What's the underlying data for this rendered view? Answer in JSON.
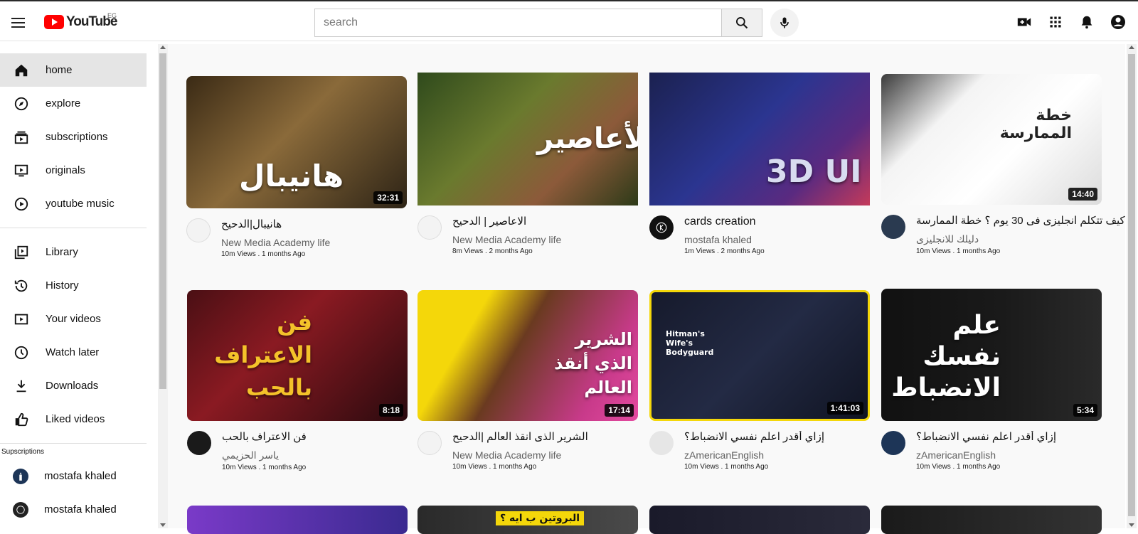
{
  "header": {
    "logo_text": "YouTube",
    "country_code": "EG",
    "search_placeholder": "search"
  },
  "sidebar": {
    "main": [
      {
        "label": "home",
        "icon": "home-icon",
        "active": true
      },
      {
        "label": "explore",
        "icon": "compass-icon"
      },
      {
        "label": "subscriptions",
        "icon": "subscriptions-icon"
      },
      {
        "label": "originals",
        "icon": "originals-icon"
      },
      {
        "label": "youtube music",
        "icon": "music-icon"
      }
    ],
    "library": [
      {
        "label": "Library",
        "icon": "library-icon"
      },
      {
        "label": "History",
        "icon": "history-icon"
      },
      {
        "label": "Your videos",
        "icon": "your-videos-icon"
      },
      {
        "label": "Watch later",
        "icon": "clock-icon"
      },
      {
        "label": "Downloads",
        "icon": "download-icon"
      },
      {
        "label": "Liked videos",
        "icon": "thumbs-up-icon"
      }
    ],
    "subscriptions_heading": "Supscriptions",
    "subscriptions": [
      {
        "label": "mostafa khaled"
      },
      {
        "label": "mostafa khaled"
      }
    ]
  },
  "videos": [
    {
      "title": "هانيبال|الدحيح",
      "channel": "New Media Academy life",
      "stats": "10m Views . 1 months Ago",
      "duration": "32:31",
      "thumb_text": "هانيبال"
    },
    {
      "title": "الاعاصير | الدحيح",
      "channel": "New Media Academy life",
      "stats": "8m Views . 2 months Ago",
      "duration": "",
      "thumb_text": "الأعاصير"
    },
    {
      "title": "cards creation",
      "channel": "mostafa khaled",
      "stats": "1m Views . 2 months Ago",
      "duration": "",
      "thumb_text": "3D UI"
    },
    {
      "title": "كيف تتكلم انجليزى فى 30 يوم ؟ خطة الممارسة",
      "channel": "دليلك للانجليزى",
      "stats": "10m Views . 1 months Ago",
      "duration": "14:40",
      "thumb_text": "خطة الممارسة"
    },
    {
      "title": "فن الاعتراف بالحب",
      "channel": "ياسر الحزيمي",
      "stats": "10m Views . 1 months Ago",
      "duration": "8:18",
      "thumb_text": "فن الاعتراف بالحب"
    },
    {
      "title": "الشرير الذى انقذ العالم |الدحيح",
      "channel": "New Media Academy life",
      "stats": "10m Views . 1 months Ago",
      "duration": "17:14",
      "thumb_text": "الشرير الذي أنقذ العالم"
    },
    {
      "title": "إزاي أقدر اعلم نفسي الانضباط؟",
      "channel": "zAmericanEnglish",
      "stats": "10m Views . 1 months Ago",
      "duration": "1:41:03",
      "thumb_text": "Hitman's Wife's Bodyguard"
    },
    {
      "title": "إزاي أقدر اعلم نفسي الانضباط؟",
      "channel": "zAmericanEnglish",
      "stats": "10m Views . 1 months Ago",
      "duration": "5:34",
      "thumb_text": "علم نفسك الانضباط"
    }
  ],
  "bottom_row_thumb_text": [
    "",
    "البروتين ب ايه ؟",
    "",
    ""
  ]
}
